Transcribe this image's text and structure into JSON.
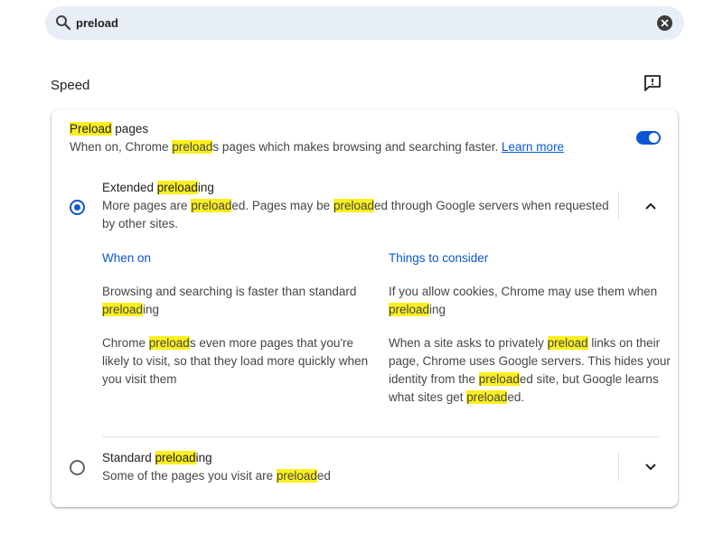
{
  "search": {
    "value": "preload"
  },
  "section": {
    "title": "Speed"
  },
  "preload_pages": {
    "title_hl": "Preload",
    "title_rest": " pages",
    "desc_1": "When on, Chrome ",
    "desc_hl": "preload",
    "desc_2": "s pages which makes browsing and searching faster. ",
    "learn_more": "Learn more",
    "toggle_on": true
  },
  "extended": {
    "title_1": "Extended ",
    "title_hl": "preload",
    "title_2": "ing",
    "desc1_1": "More pages are ",
    "desc1_hl1": "preload",
    "desc1_2": "ed. Pages may be ",
    "desc1_hl2": "preload",
    "desc1_3": "ed through Google servers when requested",
    "desc2": "by other sites.",
    "selected": true
  },
  "when_on": {
    "heading": "When on",
    "p1_line1": "Browsing and searching is faster than standard",
    "p1_hl": "preload",
    "p1_tail": "ing",
    "p2_1": "Chrome ",
    "p2_hl": "preload",
    "p2_2": "s even more pages that you're",
    "p2_line2": "likely to visit, so that they load more quickly when",
    "p2_line3": "you visit them"
  },
  "consider": {
    "heading": "Things to consider",
    "p1_line1": "If you allow cookies, Chrome may use them when",
    "p1_hl": "preload",
    "p1_tail": "ing",
    "p2_l1_1": "When a site asks to privately ",
    "p2_l1_hl": "preload",
    "p2_l1_2": " links on their",
    "p2_line2": "page, Chrome uses Google servers. This hides your",
    "p2_l3_1": "identity from the ",
    "p2_l3_hl": "preload",
    "p2_l3_2": "ed site, but Google learns",
    "p2_l4_1": "what sites get ",
    "p2_l4_hl": "preload",
    "p2_l4_2": "ed."
  },
  "standard": {
    "title_1": "Standard ",
    "title_hl": "preload",
    "title_2": "ing",
    "desc_1": "Some of the pages you visit are ",
    "desc_hl": "preload",
    "desc_2": "ed",
    "selected": false
  },
  "colors": {
    "accent": "#0b57d0",
    "highlight": "#fcef1f",
    "search_bg": "#e8eef7"
  },
  "icons": [
    "search-icon",
    "clear-icon",
    "feedback-icon",
    "chevron-up-icon",
    "chevron-down-icon"
  ]
}
